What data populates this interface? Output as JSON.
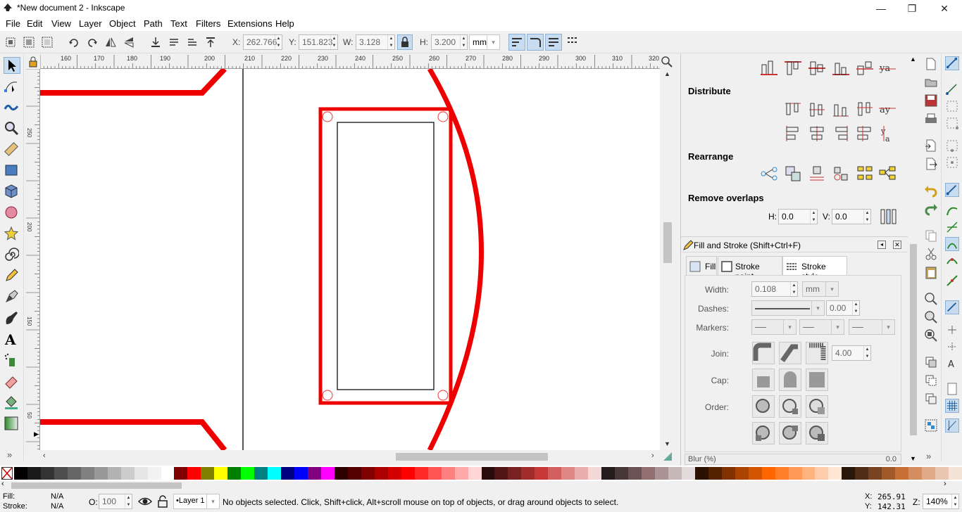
{
  "window": {
    "title": "*New document 2 - Inkscape",
    "minimize": "—",
    "maximize": "❐",
    "close": "✕"
  },
  "menu": [
    "File",
    "Edit",
    "View",
    "Layer",
    "Object",
    "Path",
    "Text",
    "Filters",
    "Extensions",
    "Help"
  ],
  "toolbar": {
    "x_label": "X:",
    "x_value": "262.766",
    "y_label": "Y:",
    "y_value": "151.823",
    "w_label": "W:",
    "w_value": "3.128",
    "h_label": "H:",
    "h_value": "3.200",
    "unit": "mm"
  },
  "ruler_top_labels": [
    "160",
    "170",
    "180",
    "190",
    "200",
    "210",
    "220",
    "230",
    "240",
    "250",
    "260",
    "270",
    "280",
    "290",
    "300",
    "310",
    "320"
  ],
  "ruler_left_labels": [
    "250",
    "200",
    "150",
    "50"
  ],
  "align_panel": {
    "distribute": "Distribute",
    "rearrange": "Rearrange",
    "remove_overlaps": "Remove overlaps",
    "h_label": "H:",
    "h_value": "0.0",
    "v_label": "V:",
    "v_value": "0.0"
  },
  "fill_stroke": {
    "title": "Fill and Stroke (Shift+Ctrl+F)",
    "tabs": [
      "Fill",
      "Stroke paint",
      "Stroke style"
    ],
    "active_tab": "Stroke style",
    "width_label": "Width:",
    "width_value": "0.108",
    "width_unit": "mm",
    "dashes_label": "Dashes:",
    "dashes_value": "0.00",
    "markers_label": "Markers:",
    "join_label": "Join:",
    "join_miter": "4.00",
    "cap_label": "Cap:",
    "order_label": "Order:",
    "blur_label": "Blur (%)",
    "blur_value": "0.0"
  },
  "status": {
    "fill_label": "Fill:",
    "fill_value": "N/A",
    "stroke_label": "Stroke:",
    "stroke_value": "N/A",
    "opacity_label": "O:",
    "opacity_value": "100",
    "layer": "•Layer 1",
    "message": "No objects selected. Click, Shift+click, Alt+scroll mouse on top of objects, or drag around objects to select.",
    "x_label": "X:",
    "x_value": "265.91",
    "y_label": "Y:",
    "y_value": "142.31",
    "zoom_label": "Z:",
    "zoom_value": "140%"
  },
  "palette_colors": [
    "#000000",
    "#1a1a1a",
    "#333333",
    "#4d4d4d",
    "#666666",
    "#808080",
    "#999999",
    "#b3b3b3",
    "#cccccc",
    "#e6e6e6",
    "#f2f2f2",
    "#ffffff",
    "#800000",
    "#ff0000",
    "#808000",
    "#ffff00",
    "#008000",
    "#00ff00",
    "#008080",
    "#00ffff",
    "#000080",
    "#0000ff",
    "#800080",
    "#ff00ff",
    "#2b0000",
    "#550000",
    "#800000",
    "#aa0000",
    "#d40000",
    "#ff0000",
    "#ff2a2a",
    "#ff5555",
    "#ff8080",
    "#ffaaaa",
    "#ffd5d5",
    "#280b0b",
    "#501616",
    "#782121",
    "#a02c2c",
    "#c83737",
    "#d35f5f",
    "#de8787",
    "#e9afaf",
    "#f4d7d7",
    "#241c1c",
    "#483737",
    "#6c5353",
    "#916f6f",
    "#ac9393",
    "#c8b7b7",
    "#e3dbdb",
    "#2b1100",
    "#552200",
    "#803300",
    "#aa4400",
    "#d45500",
    "#ff6600",
    "#ff7f2a",
    "#ff9955",
    "#ffb380",
    "#ffccaa",
    "#ffe6d5",
    "#28170b",
    "#502d16",
    "#784421",
    "#a05a2c",
    "#c87137",
    "#d38d5f",
    "#deaa87",
    "#e9c6af",
    "#f4e3d7"
  ]
}
